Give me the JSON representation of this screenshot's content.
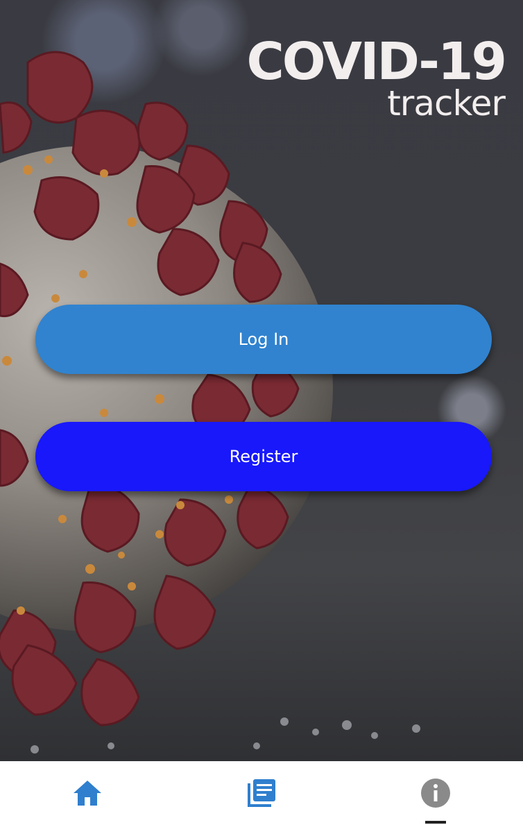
{
  "app": {
    "logo_title": "COVID-19",
    "logo_subtitle": "tracker"
  },
  "actions": {
    "login_label": "Log In",
    "register_label": "Register"
  },
  "colors": {
    "login_button": "#3183cf",
    "register_button": "#1818fb",
    "nav_active": "#2f7fce",
    "nav_inactive": "#8a8a8a"
  },
  "bottom_nav": {
    "items": [
      {
        "icon": "home-icon",
        "active": true
      },
      {
        "icon": "news-icon",
        "active": false
      },
      {
        "icon": "info-icon",
        "active": false,
        "selected_indicator": true
      }
    ]
  }
}
